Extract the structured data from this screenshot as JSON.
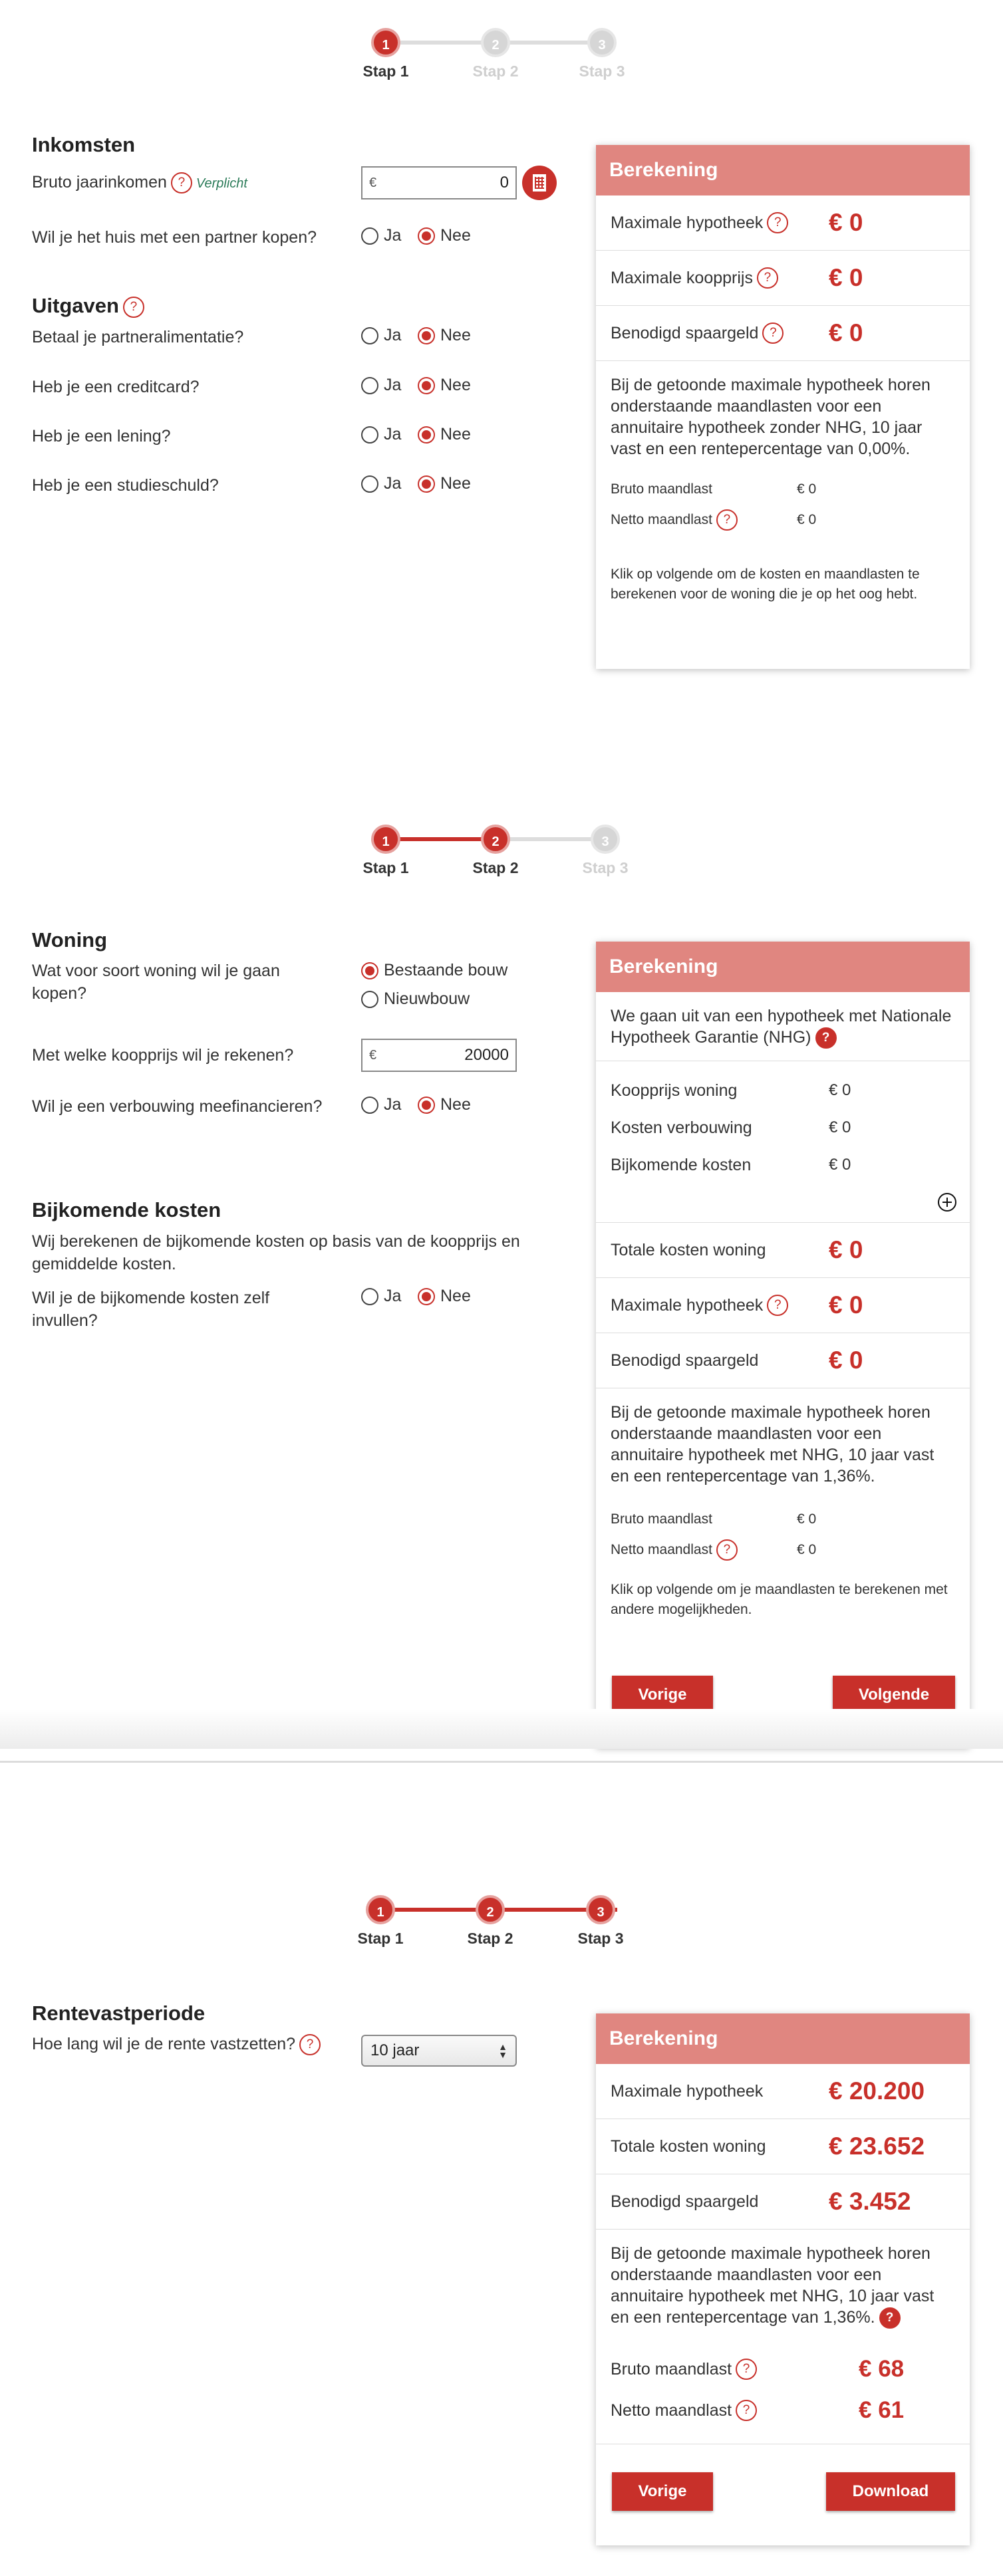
{
  "step_labels": [
    "Stap 1",
    "Stap 2",
    "Stap 3"
  ],
  "step_numbers": [
    "1",
    "2",
    "3"
  ],
  "s1": {
    "inkomsten_title": "Inkomsten",
    "bruto_label": "Bruto jaarinkomen",
    "verplicht": "Verplicht",
    "bruto_currency": "€",
    "bruto_value": "0",
    "partner_q": "Wil je het huis met een partner kopen?",
    "uitgaven_title": "Uitgaven",
    "alimentatie_q": "Betaal je partneralimentatie?",
    "creditcard_q": "Heb je een creditcard?",
    "lening_q": "Heb je een lening?",
    "studieschuld_q": "Heb je een studieschuld?",
    "ja": "Ja",
    "nee": "Nee",
    "panel": {
      "title": "Berekening",
      "max_hyp_label": "Maximale hypotheek",
      "max_hyp_value": "€ 0",
      "max_koop_label": "Maximale koopprijs",
      "max_koop_value": "€ 0",
      "spaargeld_label": "Benodigd spaargeld",
      "spaargeld_value": "€ 0",
      "text": "Bij de getoonde maximale hypotheek horen onderstaande maandlasten voor een annuitaire hypotheek zonder NHG, 10 jaar vast en een rentepercentage van 0,00%.",
      "bruto_label": "Bruto maandlast",
      "bruto_value": "€ 0",
      "netto_label": "Netto maandlast",
      "netto_value": "€ 0",
      "footer": "Klik op volgende om de kosten en maandlasten te berekenen voor de woning die je op het oog hebt."
    }
  },
  "s2": {
    "woning_title": "Woning",
    "soort_q": "Wat voor soort woning wil je gaan kopen?",
    "bestaande": "Bestaande bouw",
    "nieuwbouw": "Nieuwbouw",
    "koopprijs_q": "Met welke koopprijs wil je rekenen?",
    "koopprijs_currency": "€",
    "koopprijs_value": "20000",
    "verbouwing_q": "Wil je een verbouwing meefinancieren?",
    "bijkomende_title": "Bijkomende kosten",
    "bijkomende_text": "Wij berekenen de bijkomende kosten op basis van de koopprijs en gemiddelde kosten.",
    "zelf_q": "Wil je de bijkomende kosten zelf invullen?",
    "ja": "Ja",
    "nee": "Nee",
    "panel": {
      "title": "Berekening",
      "nhg_text": "We gaan uit van een hypotheek met Nationale Hypotheek Garantie (NHG)",
      "koopprijs_label": "Koopprijs woning",
      "koopprijs_value": "€ 0",
      "verbouwing_label": "Kosten verbouwing",
      "verbouwing_value": "€ 0",
      "bijkomend_label": "Bijkomende kosten",
      "bijkomend_value": "€ 0",
      "totale_label": "Totale kosten woning",
      "totale_value": "€ 0",
      "max_hyp_label": "Maximale hypotheek",
      "max_hyp_value": "€ 0",
      "spaargeld_label": "Benodigd spaargeld",
      "spaargeld_value": "€ 0",
      "text": "Bij de getoonde maximale hypotheek horen onderstaande maandlasten voor een annuitaire hypotheek met NHG, 10 jaar vast en een rentepercentage van 1,36%.",
      "bruto_label": "Bruto maandlast",
      "bruto_value": "€ 0",
      "netto_label": "Netto maandlast",
      "netto_value": "€ 0",
      "footer": "Klik op volgende om je maandlasten te berekenen met andere mogelijkheden.",
      "vorige": "Vorige",
      "volgende": "Volgende"
    }
  },
  "s3": {
    "rente_title": "Rentevastperiode",
    "rente_q": "Hoe lang wil je de rente vastzetten?",
    "rente_value": "10 jaar",
    "panel": {
      "title": "Berekening",
      "max_hyp_label": "Maximale hypotheek",
      "max_hyp_value": "€ 20.200",
      "totale_label": "Totale kosten woning",
      "totale_value": "€ 23.652",
      "spaargeld_label": "Benodigd spaargeld",
      "spaargeld_value": "€ 3.452",
      "text": "Bij de getoonde maximale hypotheek horen onderstaande maandlasten voor een annuitaire hypotheek met NHG, 10 jaar vast en een rentepercentage van 1,36%.",
      "bruto_label": "Bruto maandlast",
      "bruto_value": "€ 68",
      "netto_label": "Netto maandlast",
      "netto_value": "€ 61",
      "vorige": "Vorige",
      "download": "Download"
    }
  },
  "help_glyph": "?",
  "colors": {
    "accent": "#c8302a",
    "panel_header": "#e08680"
  }
}
